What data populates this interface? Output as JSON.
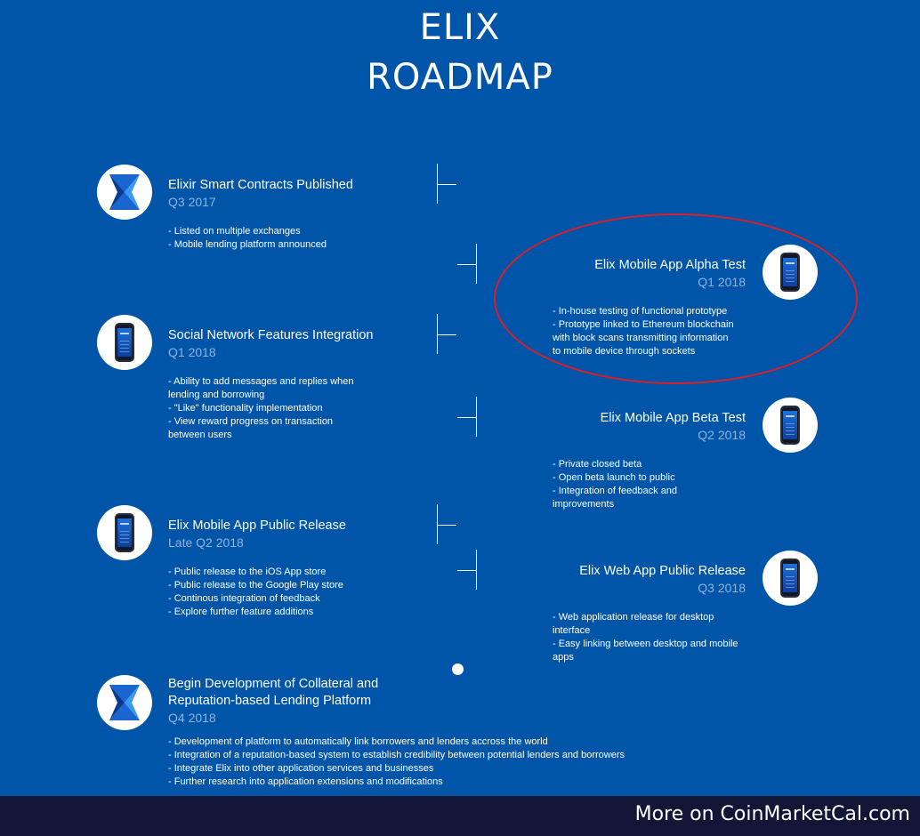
{
  "header": {
    "line1": "ELIX",
    "line2": "ROADMAP"
  },
  "events": [
    {
      "title": "Elixir Smart Contracts Published",
      "date": "Q3 2017",
      "notes": [
        "- Listed on multiple exchanges",
        "- Mobile lending platform announced"
      ],
      "icon": "elix-logo-icon"
    },
    {
      "title": "Elix Mobile App Alpha Test",
      "date": "Q1 2018",
      "notes": [
        "- In-house testing of functional prototype",
        "- Prototype linked to Ethereum blockchain",
        "with block scans transmitting information",
        "to mobile device through sockets"
      ],
      "icon": "phone-icon"
    },
    {
      "title": "Social Network Features Integration",
      "date": "Q1 2018",
      "notes": [
        "- Ability to add messages and replies when",
        "lending and borrowing",
        "- \"Like\" functionality implementation",
        "- View reward progress on transaction",
        "between users"
      ],
      "icon": "phone-icon"
    },
    {
      "title": "Elix Mobile App Beta Test",
      "date": "Q2 2018",
      "notes": [
        "- Private closed beta",
        "- Open beta launch to public",
        "- Integration of feedback and",
        "improvements"
      ],
      "icon": "phone-icon"
    },
    {
      "title": "Elix Mobile App Public Release",
      "date": "Late Q2 2018",
      "notes": [
        "- Public release to the iOS App store",
        "- Public release to the Google Play store",
        "- Continous integration of feedback",
        "- Explore further feature additions"
      ],
      "icon": "phone-icon"
    },
    {
      "title": "Elix Web App Public Release",
      "date": "Q3 2018",
      "notes": [
        "- Web application release for desktop",
        "interface",
        "- Easy linking between desktop and mobile",
        "apps"
      ],
      "icon": "phone-icon"
    },
    {
      "title_lines": [
        "Begin Development of Collateral and",
        "Reputation-based Lending Platform"
      ],
      "date": "Q4 2018",
      "notes": [
        "- Development of platform to automatically link borrowers and lenders accross the world",
        "- Integration of a reputation-based system to establish credibility between potential lenders and borrowers",
        "- Integrate Elix into other application services and businesses",
        "- Further research into application extensions and modifications"
      ],
      "icon": "elix-logo-icon"
    }
  ],
  "footer": {
    "text": "More on CoinMarketCal.com"
  },
  "colors": {
    "background": "#0055a8",
    "date": "#8fb3e3",
    "highlight": "#d8202a",
    "footer": "#121536"
  }
}
